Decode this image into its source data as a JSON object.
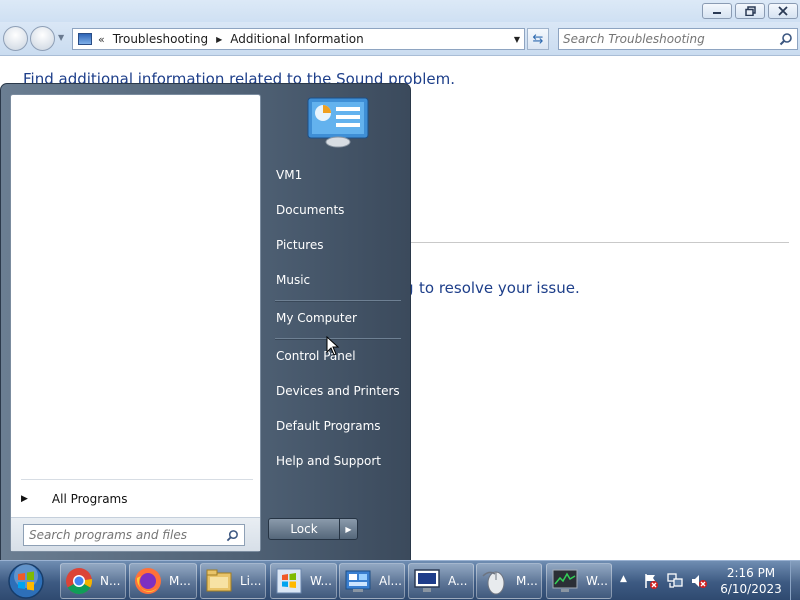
{
  "window": {
    "breadcrumb": [
      "Troubleshooting",
      "Additional Information"
    ],
    "breadcrumb_prefix": "«",
    "search_placeholder": "Search Troubleshooting",
    "heading": "Find additional information related to the Sound problem.",
    "partial_text": "to resolve your issue.",
    "partial_glyph": "g"
  },
  "start_menu": {
    "all_programs_label": "All Programs",
    "search_placeholder": "Search programs and files",
    "right_items": [
      {
        "label": "VM1",
        "icon": "user-folder-icon"
      },
      {
        "label": "Documents",
        "icon": "documents-icon"
      },
      {
        "label": "Pictures",
        "icon": "pictures-icon"
      },
      {
        "label": "Music",
        "icon": "music-icon"
      },
      {
        "label": "My Computer",
        "icon": "computer-icon"
      },
      {
        "label": "Control Panel",
        "icon": "control-panel-icon"
      },
      {
        "label": "Devices and Printers",
        "icon": "printer-icon"
      },
      {
        "label": "Default Programs",
        "icon": "default-programs-icon"
      },
      {
        "label": "Help and Support",
        "icon": "help-icon"
      }
    ],
    "lock_label": "Lock"
  },
  "taskbar": {
    "items": [
      {
        "label": "N...",
        "icon": "chrome-icon"
      },
      {
        "label": "M...",
        "icon": "firefox-icon"
      },
      {
        "label": "Li...",
        "icon": "folder-icon"
      },
      {
        "label": "W...",
        "icon": "windows-app-icon"
      },
      {
        "label": "Al...",
        "icon": "control-panel-icon"
      },
      {
        "label": "A...",
        "icon": "monitor-app-icon"
      },
      {
        "label": "M...",
        "icon": "mouse-icon"
      },
      {
        "label": "W...",
        "icon": "system-monitor-icon"
      }
    ],
    "clock_time": "2:16 PM",
    "clock_date": "6/10/2023"
  },
  "colors": {
    "link_blue": "#1e3f8a",
    "taskbar": "#3d5a82",
    "start_menu": "#4f6175"
  }
}
